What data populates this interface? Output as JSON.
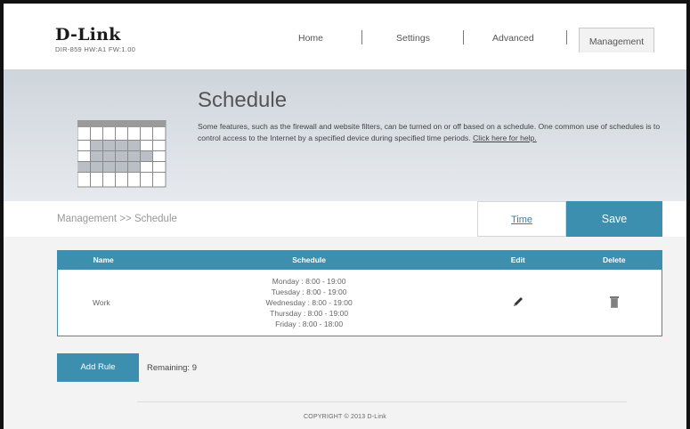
{
  "header": {
    "logo": "D-Link",
    "model": "DIR-859   HW:A1   FW:1.00",
    "nav": [
      "Home",
      "Settings",
      "Advanced",
      "Management"
    ]
  },
  "banner": {
    "title": "Schedule",
    "description": "Some features, such as the firewall and website filters, can be turned on or off based on a schedule. One common use of schedules is to control access to the Internet by a specified device during specified time periods.",
    "help_link": "Click here for help.",
    "icon": "calendar-icon"
  },
  "toolbar": {
    "breadcrumb": "Management >> Schedule",
    "time_link": "Time",
    "save_label": "Save"
  },
  "table": {
    "headers": [
      "Name",
      "Schedule",
      "Edit",
      "Delete"
    ],
    "rows": [
      {
        "name": "Work",
        "schedule": [
          "Monday : 8:00 - 19:00",
          "Tuesday : 8:00 - 19:00",
          "Wednesday : 8:00 - 19:00",
          "Thursday : 8:00 - 19:00",
          "Friday : 8:00 - 18:00"
        ],
        "edit_icon": "pencil-icon",
        "delete_icon": "trash-icon"
      }
    ]
  },
  "footer": {
    "add_rule_label": "Add Rule",
    "remaining": "Remaining: 9",
    "copyright": "COPYRIGHT © 2013 D-Link"
  },
  "colors": {
    "accent": "#3c8fae",
    "banner_bg": "#d9dee3",
    "content_bg": "#f3f3f3"
  }
}
